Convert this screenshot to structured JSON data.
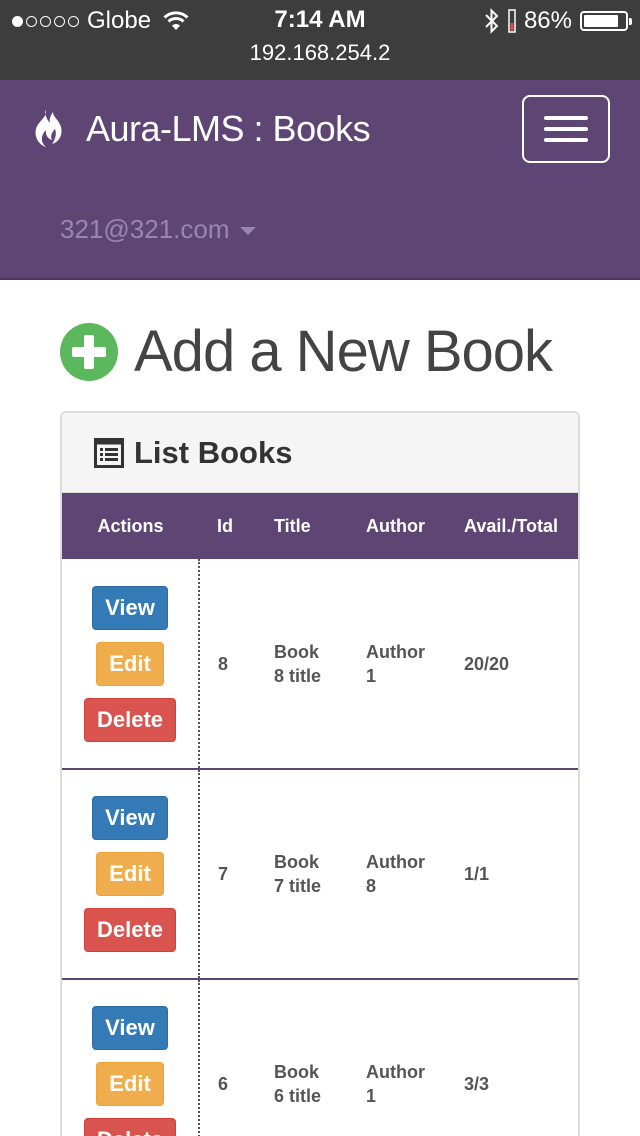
{
  "status_bar": {
    "carrier": "Globe",
    "time": "7:14 AM",
    "battery": "86%",
    "battery_level": 0.86,
    "url": "192.168.254.2"
  },
  "navbar": {
    "brand_title": "Aura-LMS : Books",
    "user_email": "321@321.com"
  },
  "page": {
    "heading": "Add a New Book"
  },
  "panel": {
    "title": "List Books",
    "columns": [
      "Actions",
      "Id",
      "Title",
      "Author",
      "Avail./Total"
    ],
    "rows": [
      {
        "id": "8",
        "title_line1": "Book",
        "title_line2": "8 title",
        "author_line1": "Author",
        "author_line2": "1",
        "avail": "20/20"
      },
      {
        "id": "7",
        "title_line1": "Book",
        "title_line2": "7 title",
        "author_line1": "Author",
        "author_line2": "8",
        "avail": "1/1"
      },
      {
        "id": "6",
        "title_line1": "Book",
        "title_line2": "6 title",
        "author_line1": "Author",
        "author_line2": "1",
        "avail": "3/3"
      }
    ],
    "buttons": {
      "view": "View",
      "edit": "Edit",
      "delete": "Delete"
    }
  },
  "colors": {
    "navbar": "#5e4574",
    "status_bar": "#3d3d3d",
    "add_icon": "#5cb85c",
    "view": "#337ab7",
    "edit": "#f0ad4e",
    "delete": "#d9534f"
  },
  "icons": {
    "brand": "flame-icon",
    "menu": "hamburger-icon",
    "add": "plus-circle-icon",
    "panel": "list-icon"
  }
}
